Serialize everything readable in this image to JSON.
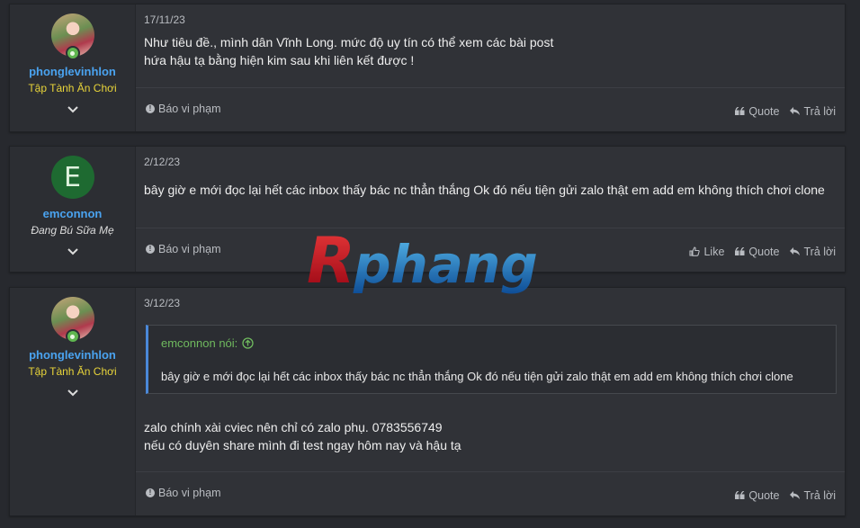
{
  "posts": [
    {
      "username": "phonglevinhlon",
      "user_title": "Tập Tành Ăn Chơi",
      "avatar_letter": "",
      "date": "17/11/23",
      "lines": [
        "Như tiêu đề., mình dân Vĩnh Long. mức độ uy tín có thể xem các bài post",
        "hứa hậu tạ bằng hiện kim sau khi liên kết được !"
      ],
      "report_label": "Báo vi phạm",
      "quote_label": "Quote",
      "reply_label": "Trả lời"
    },
    {
      "username": "emconnon",
      "user_title": "Đang Bú Sữa Mẹ",
      "avatar_letter": "E",
      "date": "2/12/23",
      "lines": [
        "bây giờ e mới đọc lại hết các inbox thấy bác nc thẳn thắng Ok đó nếu tiện gửi zalo thật em add em không thích chơi clone"
      ],
      "report_label": "Báo vi phạm",
      "like_label": "Like",
      "quote_label": "Quote",
      "reply_label": "Trả lời"
    },
    {
      "username": "phonglevinhlon",
      "user_title": "Tập Tành Ăn Chơi",
      "avatar_letter": "",
      "date": "3/12/23",
      "quote": {
        "author": "emconnon nói:",
        "text": "bây giờ e mới đọc lại hết các inbox thấy bác nc thẳn thắng Ok đó nếu tiện gửi zalo thật em add em không thích chơi clone"
      },
      "lines": [
        "zalo chính xài cviec nên chỉ có zalo phụ. 0783556749",
        "nếu có duyên share mình đi test ngay hôm nay và hậu tạ"
      ],
      "report_label": "Báo vi phạm",
      "quote_label": "Quote",
      "reply_label": "Trả lời"
    }
  ],
  "watermark_text": "Rphang",
  "colors": {
    "background": "#27292e",
    "post_bg": "#303237",
    "username": "#4aa3f0",
    "title_yellow": "#e8d43a",
    "quote_author": "#6fb95e",
    "quote_border": "#4a88d8"
  }
}
